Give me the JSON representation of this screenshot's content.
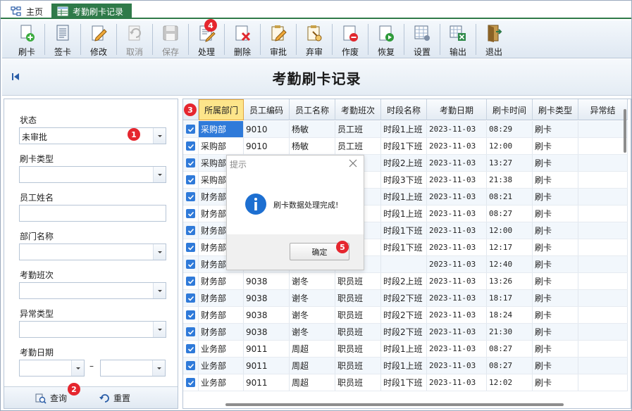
{
  "tabs": {
    "home": "主页",
    "active": "考勤刷卡记录"
  },
  "toolbar": [
    {
      "id": "swipe",
      "label": "刷卡",
      "icon": "card-add-icon",
      "enabled": true
    },
    {
      "id": "sign",
      "label": "签卡",
      "icon": "document-icon",
      "enabled": true
    },
    {
      "id": "edit",
      "label": "修改",
      "icon": "edit-pencil-icon",
      "enabled": true
    },
    {
      "id": "cancel",
      "label": "取消",
      "icon": "undo-icon",
      "enabled": false
    },
    {
      "id": "save",
      "label": "保存",
      "icon": "floppy-disk-icon",
      "enabled": false
    },
    {
      "id": "process",
      "label": "处理",
      "icon": "process-document-icon",
      "enabled": true
    },
    {
      "id": "delete",
      "label": "删除",
      "icon": "delete-document-icon",
      "enabled": true
    },
    {
      "id": "approve",
      "label": "审批",
      "icon": "approve-pencil-icon",
      "enabled": true
    },
    {
      "id": "unapprove",
      "label": "弃审",
      "icon": "unapprove-icon",
      "enabled": true
    },
    {
      "id": "void",
      "label": "作废",
      "icon": "void-document-icon",
      "enabled": true
    },
    {
      "id": "restore",
      "label": "恢复",
      "icon": "restore-document-icon",
      "enabled": true
    },
    {
      "id": "settings",
      "label": "设置",
      "icon": "settings-sheet-icon",
      "enabled": true
    },
    {
      "id": "export",
      "label": "输出",
      "icon": "excel-export-icon",
      "enabled": true
    },
    {
      "id": "exit",
      "label": "退出",
      "icon": "exit-door-icon",
      "enabled": true
    }
  ],
  "page_title": "考勤刷卡记录",
  "filters": {
    "status_label": "状态",
    "status_value": "未审批",
    "card_type_label": "刷卡类型",
    "employee_name_label": "员工姓名",
    "department_label": "部门名称",
    "shift_label": "考勤班次",
    "exception_label": "异常类型",
    "date_label": "考勤日期",
    "date_separator": "–",
    "query_button": "查询",
    "reset_button": "重置"
  },
  "badges": {
    "b1": "1",
    "b2": "2",
    "b3": "3",
    "b4": "4",
    "b5": "5"
  },
  "grid": {
    "columns": [
      "",
      "所属部门",
      "员工编码",
      "员工名称",
      "考勤班次",
      "时段名称",
      "考勤日期",
      "刷卡时间",
      "刷卡类型",
      "异常结"
    ],
    "rows": [
      [
        "采购部",
        "9010",
        "杨敏",
        "员工班",
        "时段1上班",
        "2023-11-03",
        "08:29",
        "刷卡"
      ],
      [
        "采购部",
        "9010",
        "杨敏",
        "员工班",
        "时段1下班",
        "2023-11-03",
        "12:00",
        "刷卡"
      ],
      [
        "采购部",
        "",
        "",
        "",
        "时段2上班",
        "2023-11-03",
        "13:27",
        "刷卡"
      ],
      [
        "采购部",
        "",
        "",
        "",
        "时段3下班",
        "2023-11-03",
        "21:38",
        "刷卡"
      ],
      [
        "财务部",
        "",
        "",
        "",
        "时段1上班",
        "2023-11-03",
        "08:21",
        "刷卡"
      ],
      [
        "财务部",
        "",
        "",
        "",
        "时段1上班",
        "2023-11-03",
        "08:27",
        "刷卡"
      ],
      [
        "财务部",
        "",
        "",
        "",
        "时段1下班",
        "2023-11-03",
        "12:00",
        "刷卡"
      ],
      [
        "财务部",
        "",
        "",
        "",
        "时段1下班",
        "2023-11-03",
        "12:17",
        "刷卡"
      ],
      [
        "财务部",
        "",
        "",
        "",
        "",
        "2023-11-03",
        "12:40",
        "刷卡"
      ],
      [
        "财务部",
        "9038",
        "谢冬",
        "职员班",
        "时段2上班",
        "2023-11-03",
        "13:26",
        "刷卡"
      ],
      [
        "财务部",
        "9038",
        "谢冬",
        "职员班",
        "时段2下班",
        "2023-11-03",
        "18:17",
        "刷卡"
      ],
      [
        "财务部",
        "9038",
        "谢冬",
        "职员班",
        "时段2下班",
        "2023-11-03",
        "18:24",
        "刷卡"
      ],
      [
        "财务部",
        "9038",
        "谢冬",
        "职员班",
        "时段2下班",
        "2023-11-03",
        "21:30",
        "刷卡"
      ],
      [
        "业务部",
        "9011",
        "周超",
        "职员班",
        "时段1上班",
        "2023-11-03",
        "08:27",
        "刷卡"
      ],
      [
        "业务部",
        "9011",
        "周超",
        "职员班",
        "时段1上班",
        "2023-11-03",
        "08:27",
        "刷卡"
      ],
      [
        "业务部",
        "9011",
        "周超",
        "职员班",
        "时段1下班",
        "2023-11-03",
        "12:02",
        "刷卡"
      ]
    ]
  },
  "dialog": {
    "title": "提示",
    "message": "刷卡数据处理完成!",
    "ok_button": "确定"
  },
  "colors": {
    "tab_active": "#2f7a49",
    "selection": "#2f7ad9",
    "badge": "#e5262e",
    "header_selected": "#fde58a"
  }
}
